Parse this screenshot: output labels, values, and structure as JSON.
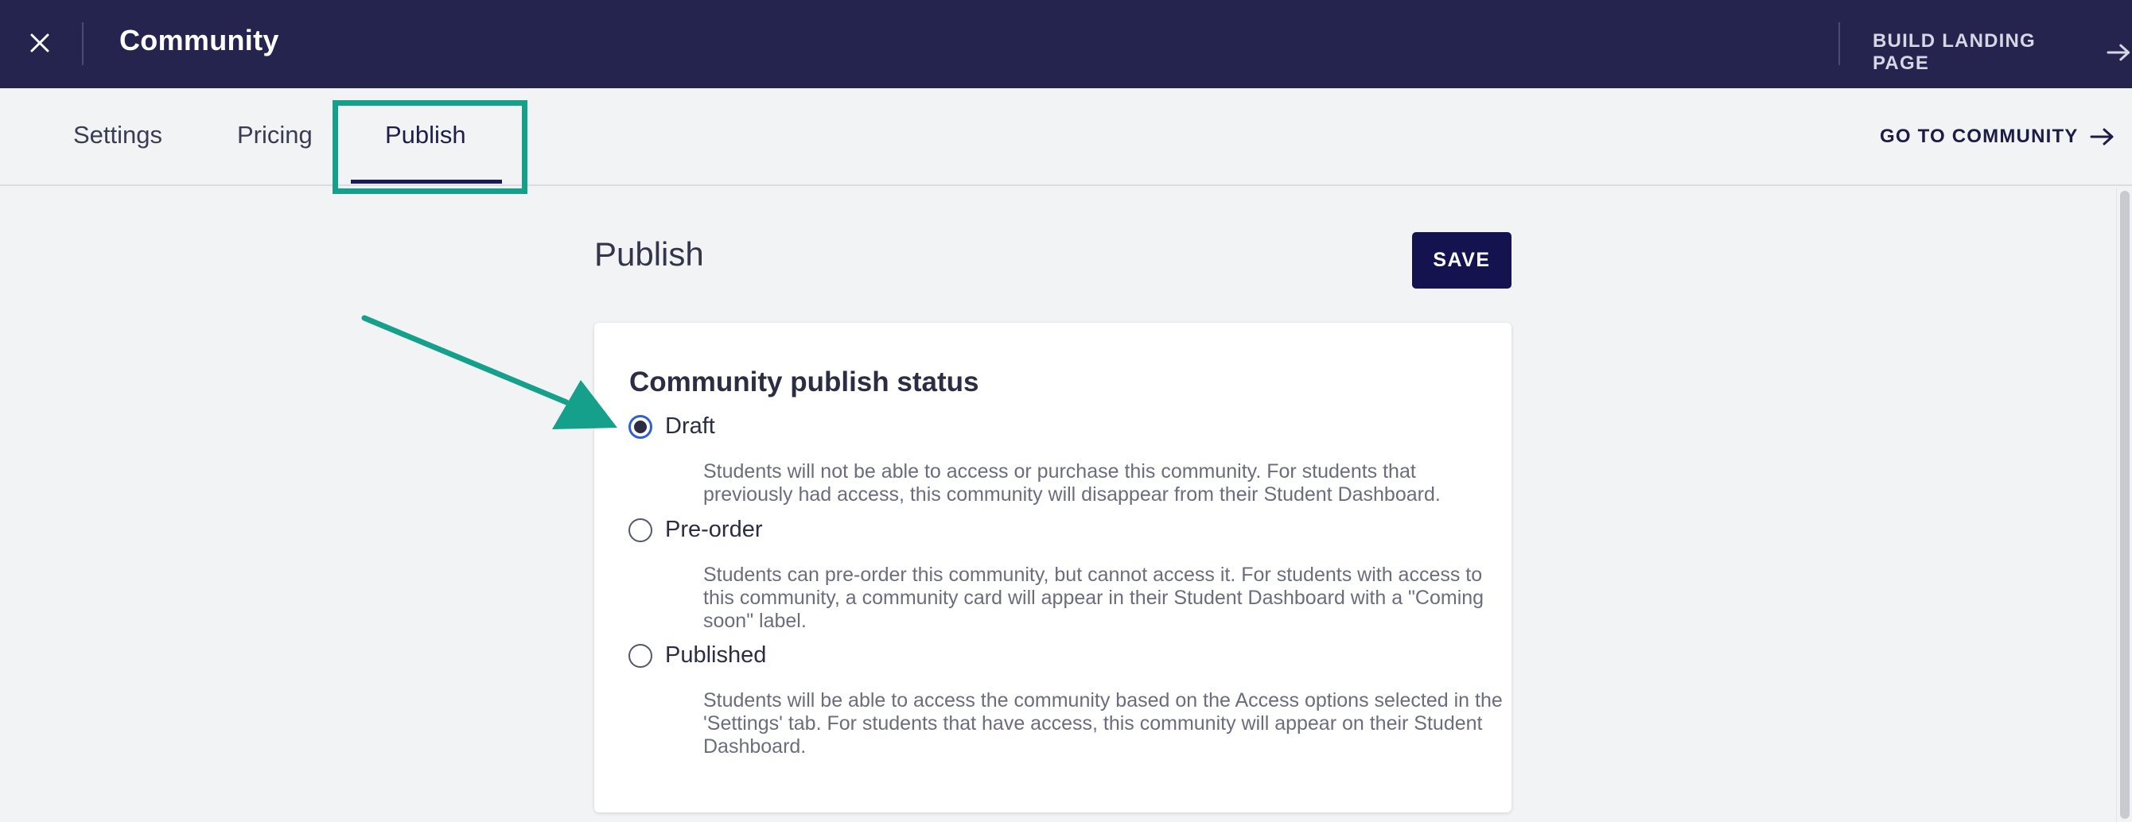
{
  "topbar": {
    "title": "Community",
    "build_landing_label": "BUILD LANDING PAGE",
    "close_icon": "close-icon",
    "arrow_icon": "arrow-right-icon"
  },
  "tabs": [
    {
      "label": "Settings",
      "active": false
    },
    {
      "label": "Pricing",
      "active": false
    },
    {
      "label": "Publish",
      "active": true
    }
  ],
  "go_community_label": "GO TO COMMUNITY",
  "main": {
    "heading": "Publish",
    "save_label": "SAVE",
    "card": {
      "title": "Community publish status",
      "options": [
        {
          "label": "Draft",
          "checked": true,
          "description": "Students will not be able to access or purchase this community. For students that previously had access, this community will disappear from their Student Dashboard."
        },
        {
          "label": "Pre-order",
          "checked": false,
          "description": "Students can pre-order this community, but cannot access it. For students with access to this community, a community card will appear in their Student Dashboard with a \"Coming soon\" label."
        },
        {
          "label": "Published",
          "checked": false,
          "description": "Students will be able to access the community based on the Access options selected in the 'Settings' tab. For students that have access, this community will appear on their Student Dashboard."
        }
      ]
    }
  },
  "colors": {
    "topbar": "#24244e",
    "accent_dark": "#14124f",
    "annotation": "#14a08b",
    "radio_selected": "#2f5fd0"
  }
}
